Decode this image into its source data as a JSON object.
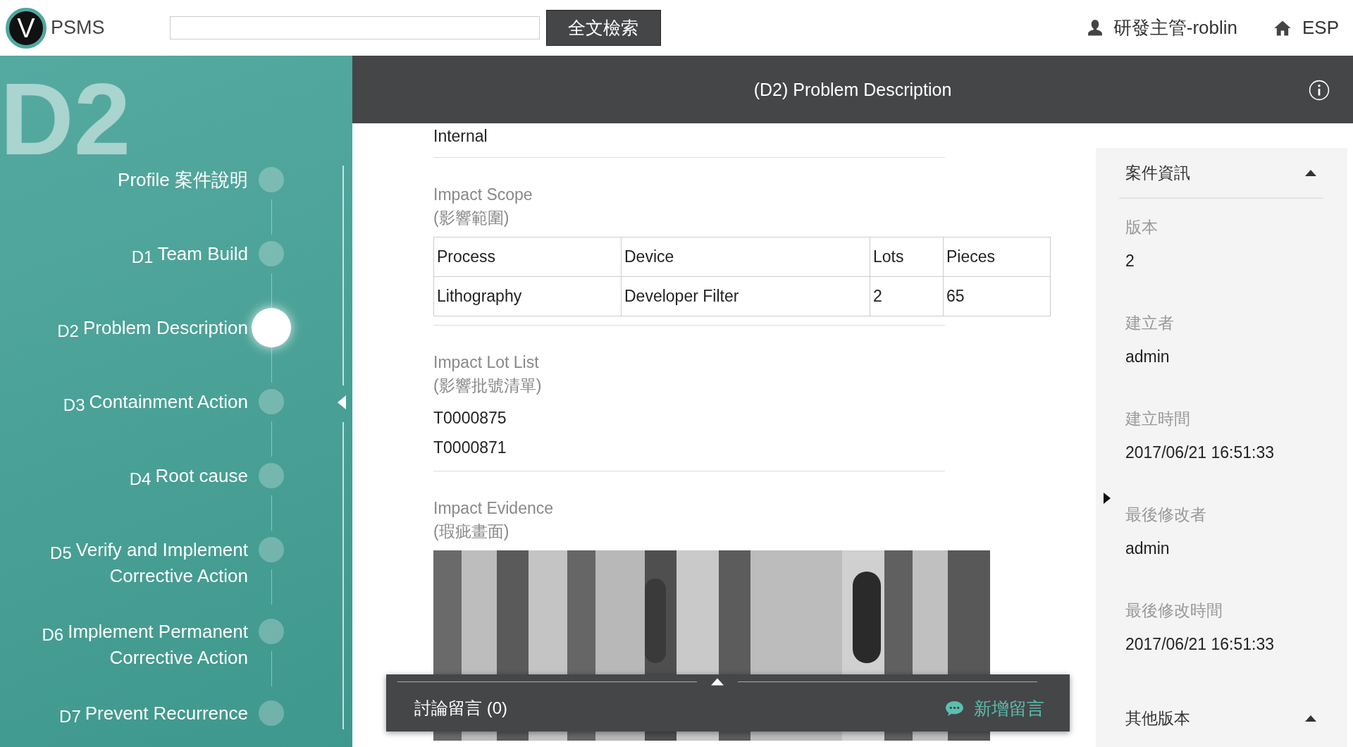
{
  "header": {
    "logo_letter": "V",
    "brand": "PSMS",
    "search_button": "全文檢索",
    "user": "研發主管-roblin",
    "home": "ESP"
  },
  "sidebar": {
    "watermark": "D2",
    "steps": [
      {
        "label": "Profile 案件說明",
        "selected": false
      },
      {
        "code": "D1",
        "label": "Team Build",
        "selected": false
      },
      {
        "code": "D2",
        "label": "Problem Description",
        "selected": true
      },
      {
        "code": "D3",
        "label": "Containment Action",
        "selected": false
      },
      {
        "code": "D4",
        "label": "Root cause",
        "selected": false
      },
      {
        "code": "D5",
        "label": "Verify and Implement Corrective Action",
        "selected": false
      },
      {
        "code": "D6",
        "label": "Implement Permanent Corrective Action",
        "selected": false
      },
      {
        "code": "D7",
        "label": "Prevent Recurrence",
        "selected": false
      }
    ]
  },
  "page_title": "(D2) Problem Description",
  "sections": [
    {
      "kind": "text",
      "value": "Internal"
    },
    {
      "kind": "table",
      "title": "Impact Scope",
      "subtitle": "(影響範圍)",
      "columns": [
        "Process",
        "Device",
        "Lots",
        "Pieces"
      ],
      "rows": [
        [
          "Lithography",
          "Developer Filter",
          "2",
          "65"
        ]
      ]
    },
    {
      "kind": "list",
      "title": "Impact Lot List",
      "subtitle": "(影響批號清單)",
      "items": [
        "T0000875",
        "T0000871"
      ]
    },
    {
      "kind": "picture",
      "title": "Impact Evidence",
      "subtitle": "(瑕疵畫面)"
    }
  ],
  "comments": {
    "label": "討論留言 (0)",
    "add": "新增留言"
  },
  "info_panel": {
    "title": "案件資訊",
    "expanded": true,
    "fields": [
      {
        "label": "版本",
        "value": "2"
      },
      {
        "label": "建立者",
        "value": "admin"
      },
      {
        "label": "建立時間",
        "value": "2017/06/21 16:51:33"
      },
      {
        "label": "最後修改者",
        "value": "admin"
      },
      {
        "label": "最後修改時間",
        "value": "2017/06/21 16:51:33"
      }
    ]
  },
  "other_versions": {
    "title": "其他版本",
    "expanded": true
  }
}
